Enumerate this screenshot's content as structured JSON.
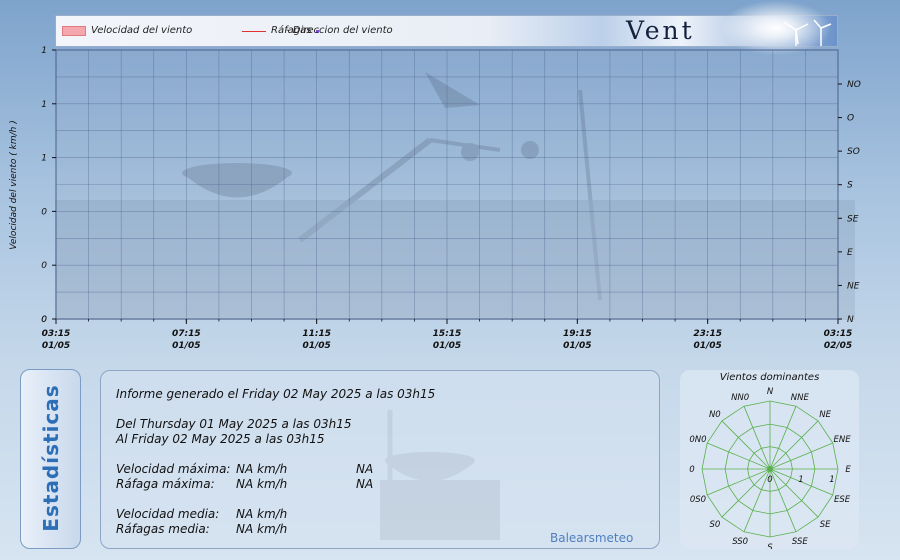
{
  "legend": {
    "speed": "Velocidad del viento",
    "gusts": "Ráfagas",
    "direction": "- Direccion del viento",
    "title": "Vent"
  },
  "colors": {
    "grid": "#4b5f8a",
    "speed_fill": "#f4a8ad",
    "gust_line": "#e03030",
    "direction_dot": "#7a4fd0",
    "stats_label": "#2d6fb6",
    "rose_lines": "#58b04c",
    "brand": "#4f7fc0"
  },
  "chart_data": [
    {
      "type": "line",
      "ylabel": "Velocidad del viento ( km/h )",
      "y_ticks_left": [
        "1",
        "1",
        "1",
        "0",
        "0",
        "0"
      ],
      "y_ticks_right": [
        "NO",
        "O",
        "SO",
        "S",
        "SE",
        "E",
        "NE",
        "N"
      ],
      "x_ticks": [
        {
          "time": "03:15",
          "date": "01/05"
        },
        {
          "time": "07:15",
          "date": "01/05"
        },
        {
          "time": "11:15",
          "date": "01/05"
        },
        {
          "time": "15:15",
          "date": "01/05"
        },
        {
          "time": "19:15",
          "date": "01/05"
        },
        {
          "time": "23:15",
          "date": "01/05"
        },
        {
          "time": "03:15",
          "date": "02/05"
        }
      ],
      "series": [
        {
          "name": "Velocidad del viento",
          "values": []
        },
        {
          "name": "Ráfagas",
          "values": []
        },
        {
          "name": "- Direccion del viento",
          "values": []
        }
      ],
      "grid": true,
      "legend_position": "top"
    },
    {
      "type": "radar",
      "title": "Vientos dominantes",
      "directions": [
        "N",
        "NNE",
        "NE",
        "ENE",
        "E",
        "ESE",
        "SE",
        "SSE",
        "S",
        "SS0",
        "S0",
        "0S0",
        "0",
        "0N0",
        "N0",
        "NN0"
      ],
      "ring_labels": [
        "0",
        "1",
        "1"
      ],
      "values": []
    }
  ],
  "stats": {
    "tab_label": "Estadísticas",
    "generated": "Informe generado el Friday 02 May 2025 a las 03h15",
    "from": "Del Thursday 01 May 2025 a las 03h15",
    "to": "Al Friday 02 May 2025 a las 03h15",
    "max_speed_label": "Velocidad máxima:",
    "max_speed_value": "NA km/h",
    "max_speed_extra": "NA",
    "max_gust_label": "Ráfaga máxima:",
    "max_gust_value": "NA km/h",
    "max_gust_extra": "NA",
    "avg_speed_label": "Velocidad media:",
    "avg_speed_value": "NA km/h",
    "avg_gust_label": "Ráfagas media:",
    "avg_gust_value": "NA km/h",
    "brand": "Balearsmeteo"
  }
}
